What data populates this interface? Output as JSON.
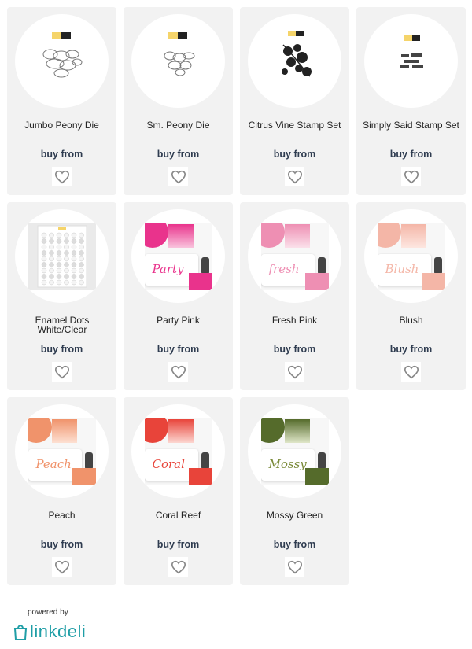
{
  "products": [
    {
      "title": "Jumbo Peony Die",
      "buy_label": "buy from"
    },
    {
      "title": "Sm. Peony Die",
      "buy_label": "buy from"
    },
    {
      "title": "Citrus Vine Stamp Set",
      "buy_label": "buy from"
    },
    {
      "title": "Simply Said Stamp Set",
      "buy_label": "buy from"
    },
    {
      "title": "Enamel Dots White/Clear",
      "buy_label": "buy from"
    },
    {
      "title": "Party Pink",
      "buy_label": "buy from"
    },
    {
      "title": "Fresh Pink",
      "buy_label": "buy from"
    },
    {
      "title": "Blush",
      "buy_label": "buy from"
    },
    {
      "title": "Peach",
      "buy_label": "buy from"
    },
    {
      "title": "Coral Reef",
      "buy_label": "buy from"
    },
    {
      "title": "Mossy Green",
      "buy_label": "buy from"
    }
  ],
  "ink_pad_labels": {
    "party": "Party",
    "fresh": "fresh",
    "blush": "Blush",
    "peach": "Peach",
    "coral": "Coral",
    "mossy": "Mossy"
  },
  "footer": {
    "powered_by": "powered by",
    "brand": "linkdeli"
  },
  "colors": {
    "card_bg": "#f2f2f2",
    "buy_text": "#2f3c50",
    "brand": "#1f9ea6",
    "party_pink": "#e9338c",
    "fresh_pink": "#ee8fb3",
    "blush": "#f4b6a7",
    "peach": "#f0936b",
    "coral_reef": "#e8443a",
    "mossy_green": "#556b2b"
  }
}
